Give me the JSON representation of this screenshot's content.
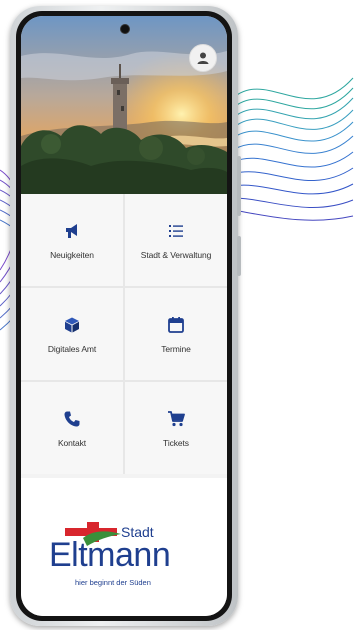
{
  "header": {
    "profile_icon": "user-icon"
  },
  "tiles": [
    {
      "label": "Neuigkeiten",
      "icon": "megaphone-icon"
    },
    {
      "label": "Stadt & Verwaltung",
      "icon": "list-icon"
    },
    {
      "label": "Digitales Amt",
      "icon": "cube-icon"
    },
    {
      "label": "Termine",
      "icon": "calendar-icon"
    },
    {
      "label": "Kontakt",
      "icon": "phone-icon"
    },
    {
      "label": "Tickets",
      "icon": "cart-icon"
    }
  ],
  "logo": {
    "stadt": "Stadt",
    "name": "Eltmann",
    "tagline": "hier beginnt der Süden"
  },
  "colors": {
    "accent": "#1f3f8f",
    "logo_red": "#d8262d",
    "logo_green": "#3a8f3a",
    "wave_teal": "#2fa7a0",
    "wave_blue": "#3457c9",
    "wave_purple": "#7a4bc9"
  }
}
